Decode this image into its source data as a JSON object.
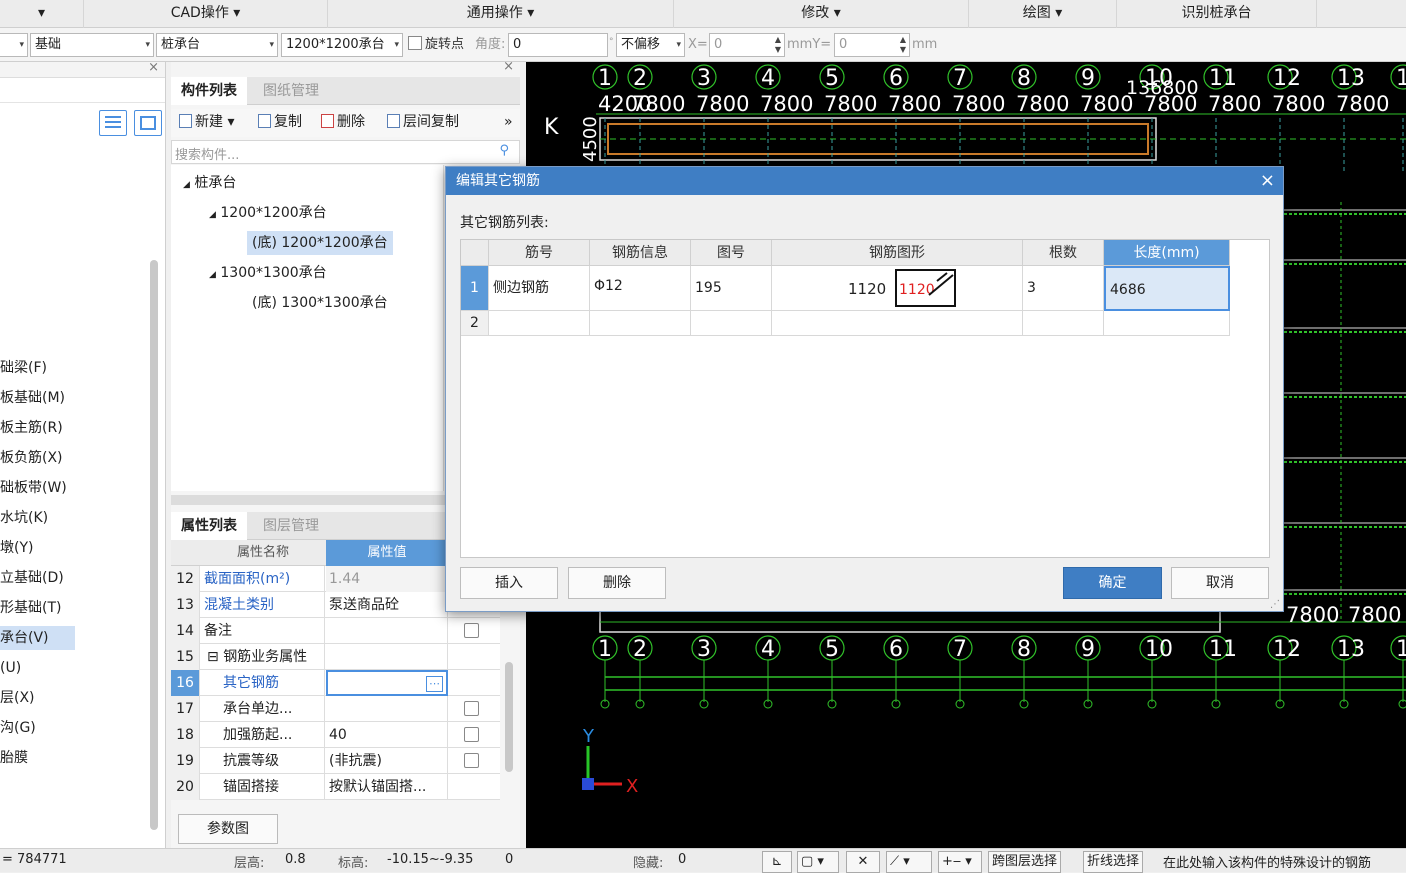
{
  "menubar": {
    "items": [
      "CAD操作",
      "通用操作",
      "修改",
      "绘图",
      "识别桩承台"
    ]
  },
  "toolbar": {
    "floor": "基础",
    "type": "桩承台",
    "component": "1200*1200承台",
    "rotate_label": "旋转点",
    "angle_label": "角度:",
    "angle_value": "0",
    "offset_mode": "不偏移",
    "x_label": "X=",
    "x_value": "0",
    "mm_y_label": "mmY=",
    "y_value": "0",
    "mm_label": "mm"
  },
  "left_panel": {
    "items": [
      "础梁(F)",
      "板基础(M)",
      "板主筋(R)",
      "板负筋(X)",
      "础板带(W)",
      "水坑(K)",
      "墩(Y)",
      "立基础(D)",
      "形基础(T)",
      "承台(V)",
      "(U)",
      "层(X)",
      "沟(G)",
      "胎膜"
    ],
    "selected_index": 9
  },
  "component_panel": {
    "tabs": [
      "构件列表",
      "图纸管理"
    ],
    "buttons": {
      "new": "新建",
      "copy": "复制",
      "delete": "删除",
      "floor_copy": "层间复制"
    },
    "search_placeholder": "搜索构件...",
    "tree": {
      "root": "桩承台",
      "group1": "1200*1200承台",
      "leaf1": "(底) 1200*1200承台",
      "group2": "1300*1300承台",
      "leaf2": "(底) 1300*1300承台"
    }
  },
  "property_panel": {
    "tabs": [
      "属性列表",
      "图层管理"
    ],
    "header_name": "属性名称",
    "header_value": "属性值",
    "rows": [
      {
        "no": "12",
        "name": "截面面积(m²)",
        "value": "1.44"
      },
      {
        "no": "13",
        "name": "混凝土类别",
        "value": "泵送商品砼"
      },
      {
        "no": "14",
        "name": "备注",
        "value": ""
      },
      {
        "no": "15",
        "name": "钢筋业务属性",
        "value": ""
      },
      {
        "no": "16",
        "name": "其它钢筋",
        "value": ""
      },
      {
        "no": "17",
        "name": "承台单边...",
        "value": ""
      },
      {
        "no": "18",
        "name": "加强筋起...",
        "value": "40"
      },
      {
        "no": "19",
        "name": "抗震等级",
        "value": "(非抗震)"
      },
      {
        "no": "20",
        "name": "锚固搭接",
        "value": "按默认锚固搭..."
      }
    ],
    "param_button": "参数图"
  },
  "cad": {
    "axis_numbers": [
      "1",
      "2",
      "3",
      "4",
      "5",
      "6",
      "7",
      "8",
      "9",
      "10",
      "11",
      "12",
      "13",
      "1"
    ],
    "dim_labels": [
      "4200",
      "7800",
      "7800",
      "7800",
      "7800",
      "7800",
      "7800",
      "7800",
      "7800",
      "7800",
      "7800",
      "7800",
      "7800"
    ],
    "total_dim": "136800",
    "row_label": "K",
    "side_dim": "4500",
    "axis_x": "X",
    "axis_y": "Y"
  },
  "dialog": {
    "title": "编辑其它钢筋",
    "list_label": "其它钢筋列表:",
    "columns": [
      "筋号",
      "钢筋信息",
      "图号",
      "钢筋图形",
      "根数",
      "长度(mm)"
    ],
    "rows": [
      {
        "no": "1",
        "name": "侧边钢筋",
        "info": "Φ12",
        "fig": "195",
        "shape_len": "1120",
        "shape_label": "1120",
        "count": "3",
        "length": "4686"
      },
      {
        "no": "2",
        "name": "",
        "info": "",
        "fig": "",
        "shape_len": "",
        "shape_label": "",
        "count": "",
        "length": ""
      }
    ],
    "btn_insert": "插入",
    "btn_delete": "删除",
    "btn_ok": "确定",
    "btn_cancel": "取消",
    "close": "×"
  },
  "statusbar": {
    "coord": "= 784771",
    "floor_height_label": "层高:",
    "floor_height": "0.8",
    "elev_label": "标高:",
    "elev": "-10.15~-9.35",
    "zero": "0",
    "hidden_label": "隐藏:",
    "hidden": "0",
    "cross_select": "跨图层选择",
    "polyline_select": "折线选择",
    "hint": "在此处输入该构件的特殊设计的钢筋"
  },
  "colors": {
    "accent": "#3f7ec4",
    "grid_green": "#31c22a",
    "cad_bg": "#000000",
    "rebar_red": "#e02020"
  }
}
